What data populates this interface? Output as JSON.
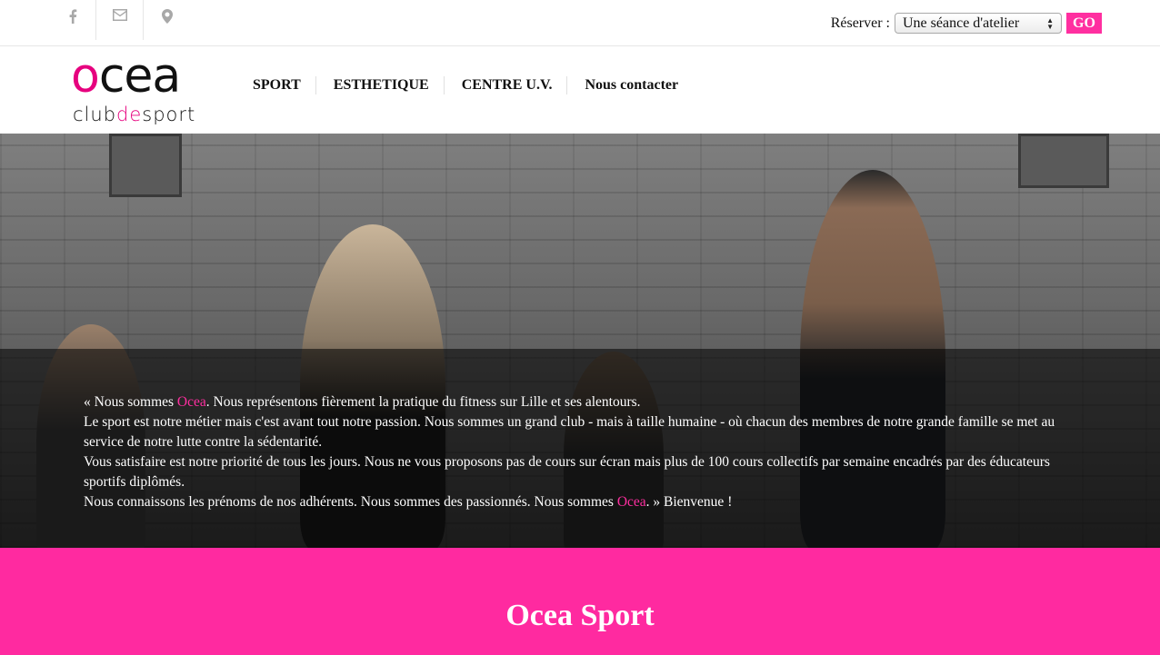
{
  "topbar": {
    "social": [
      {
        "icon": "facebook-icon"
      },
      {
        "icon": "envelope-icon"
      },
      {
        "icon": "map-marker-icon"
      }
    ],
    "reserve_label": "Réserver :",
    "reserve_select_value": "Une séance d'atelier",
    "go_label": "GO"
  },
  "logo": {
    "word_o": "o",
    "word_rest": "cea",
    "sub_club": "club",
    "sub_de": "de",
    "sub_sport": "sport"
  },
  "nav": {
    "items": [
      "SPORT",
      "ESTHETIQUE",
      "CENTRE U.V.",
      "Nous contacter"
    ]
  },
  "hero": {
    "l1_a": "« Nous sommes ",
    "l1_hl": "Ocea",
    "l1_b": ". Nous représentons fièrement la pratique du fitness sur Lille et ses alentours.",
    "l2": "Le sport est notre métier mais c'est avant tout notre passion. Nous sommes un grand club - mais à taille humaine - où chacun des membres de notre grande famille se met au service de notre lutte contre la sédentarité.",
    "l3": "Vous satisfaire est notre priorité de tous les jours. Nous ne vous proposons pas de cours sur écran mais plus de 100 cours collectifs par semaine encadrés par des éducateurs sportifs diplômés.",
    "l4_a": "Nous connaissons les prénoms de nos adhérents. Nous sommes des passionnés. Nous sommes ",
    "l4_hl": "Ocea",
    "l4_b": ". » Bienvenue !"
  },
  "band": {
    "title": "Ocea Sport"
  },
  "colors": {
    "accent": "#ff2aa0",
    "logo_pink": "#e6007e"
  }
}
